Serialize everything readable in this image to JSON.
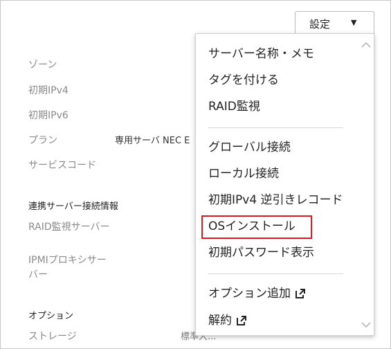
{
  "settings_button": {
    "label": "設定",
    "caret": "▼"
  },
  "details": {
    "labels": [
      "ゾーン",
      "初期IPv4",
      "初期IPv6",
      "プラン",
      "サービスコード"
    ],
    "plan_value": "専用サーバ NEC E",
    "linked_section_title": "連携サーバー接続情報",
    "raid_label": "RAID監視サーバー",
    "ipmi_label_line1": "IPMIプロキシサー",
    "ipmi_label_line2": "バー",
    "options_title": "オプション",
    "storage_label": "ストレージ",
    "storage_value": "標準大..."
  },
  "menu": {
    "items": [
      "サーバー名称・メモ",
      "タグを付ける",
      "RAID監視",
      "グローバル接続",
      "ローカル接続",
      "初期IPv4 逆引きレコード",
      "OSインストール",
      "初期パスワード表示",
      "オプション追加",
      "解約"
    ],
    "highlighted_item": "OSインストール"
  },
  "colors": {
    "highlight_border": "#e0161a",
    "label_gray": "#8a8a8a"
  }
}
